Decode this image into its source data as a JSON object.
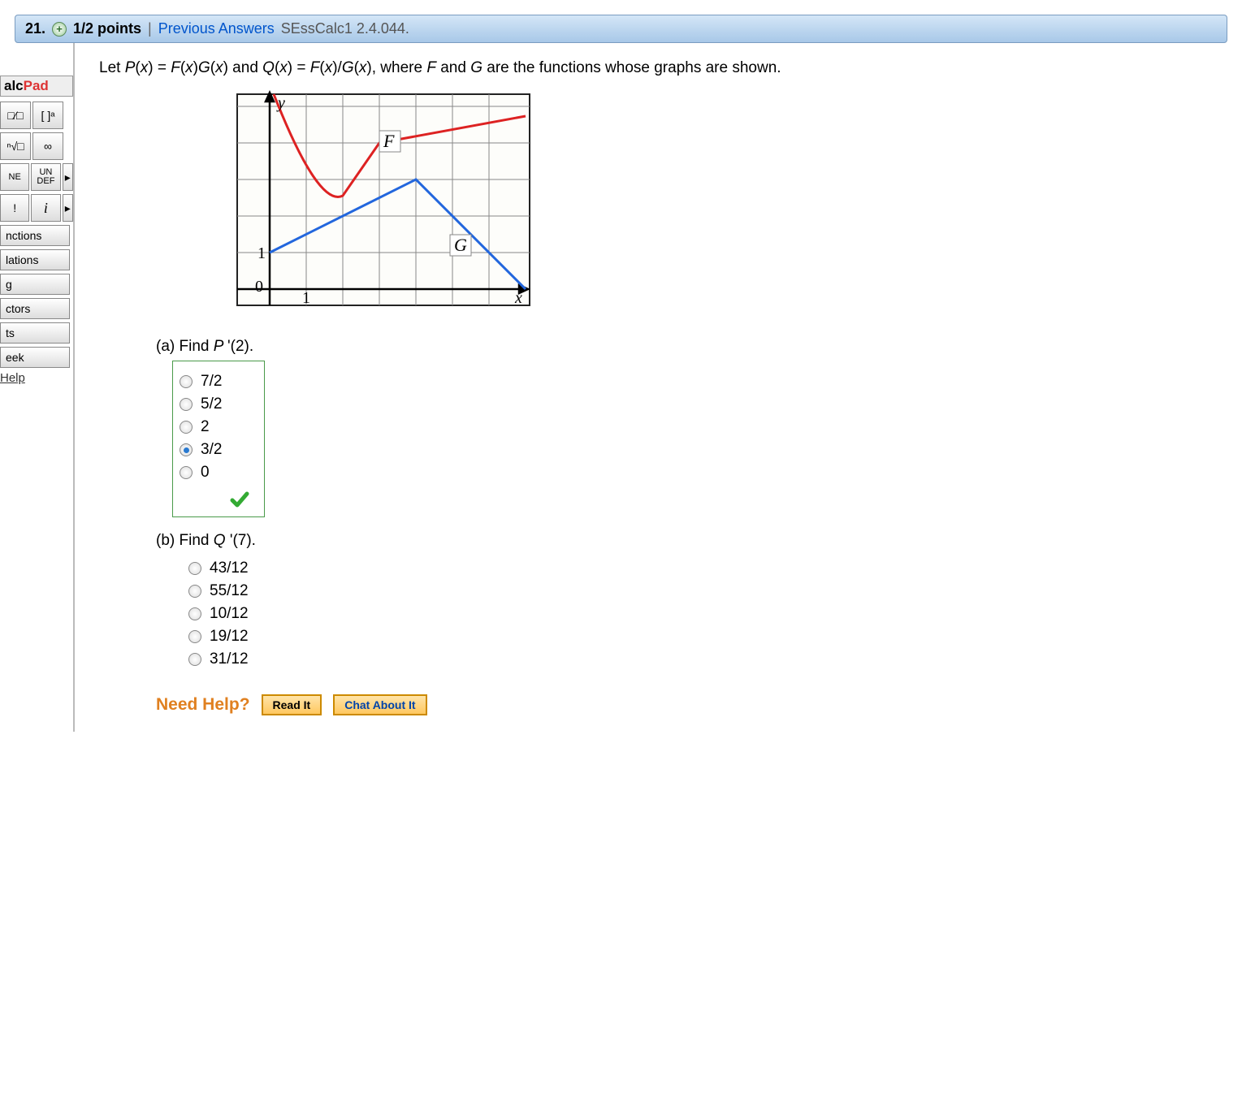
{
  "header": {
    "number": "21.",
    "points": "1/2 points",
    "separator": "|",
    "prev": "Previous Answers",
    "ref": "SEssCalc1 2.4.044."
  },
  "sidebar": {
    "title_a": "alc",
    "title_b": "Pad",
    "btn_frac": "□⁄□",
    "btn_paren": "[ ]ᵃ",
    "btn_root": "ⁿ√□",
    "btn_inf": "∞",
    "btn_ne": "NE",
    "btn_undef_t": "UN",
    "btn_undef_b": "DEF",
    "btn_arrow": "▸",
    "btn_excl": "!",
    "btn_i": "i",
    "btn_tri": "▸",
    "tabs": [
      "nctions",
      "lations",
      "g",
      "ctors",
      "ts",
      "eek"
    ],
    "help": "Help"
  },
  "prompt": {
    "pre": "Let ",
    "p": "P",
    "x": "x",
    "eq1_mid": "(",
    "eq1": ") = ",
    "f": "F",
    "g": "G",
    "mul_mid": ")",
    "and": " and ",
    "q": "Q",
    "div": ")/",
    "tail": "), where ",
    "f2": "F",
    "and2": " and ",
    "g2": "G",
    "rest": " are the functions whose graphs are shown."
  },
  "graph": {
    "y": "y",
    "x": "x",
    "F": "F",
    "G": "G",
    "zero": "0",
    "one_y": "1",
    "one_x": "1"
  },
  "partA": {
    "label": "(a) Find ",
    "p": "P ",
    "prime": "'(2).",
    "options": [
      "7/2",
      "5/2",
      "2",
      "3/2",
      "0"
    ],
    "selected": 3
  },
  "partB": {
    "label": "(b) Find ",
    "q": "Q ",
    "prime": "'(7).",
    "options": [
      "43/12",
      "55/12",
      "10/12",
      "19/12",
      "31/12"
    ]
  },
  "help": {
    "label": "Need Help?",
    "read": "Read It",
    "chat": "Chat About It"
  }
}
